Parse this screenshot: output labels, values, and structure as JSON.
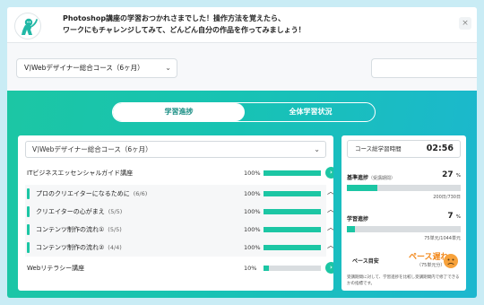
{
  "banner": {
    "line1": "Photoshop講座の学習おつかれさまでした！操作方法を覚えたら、",
    "line2": "ワークにもチャレンジしてみて、どんどん自分の作品を作ってみましょう！",
    "close": "×"
  },
  "course_select": {
    "value": "V)Webデザイナー総合コース（6ヶ月）",
    "chevron": "⌄"
  },
  "tabs": [
    {
      "label": "学習進捗",
      "active": true
    },
    {
      "label": "全体学習状況",
      "active": false
    }
  ],
  "progress_card": {
    "course_select": {
      "value": "V)Webデザイナー総合コース（6ヶ月）",
      "chevron": "⌄"
    },
    "rows": [
      {
        "label": "ITビジネスエッセンシャルガイド講座",
        "count": "",
        "percent": "100%",
        "progress": 1.0,
        "action": "›",
        "kind": "course"
      },
      {
        "label": "プロのクリエイターになるために",
        "count": "(6/6)",
        "percent": "100%",
        "progress": 1.0,
        "action": "︿",
        "kind": "chapter"
      },
      {
        "label": "クリエイターの心がまえ",
        "count": "(5/5)",
        "percent": "100%",
        "progress": 1.0,
        "action": "︿",
        "kind": "chapter"
      },
      {
        "label": "コンテンツ制作の流れ①",
        "count": "(5/5)",
        "percent": "100%",
        "progress": 1.0,
        "action": "︿",
        "kind": "chapter"
      },
      {
        "label": "コンテンツ制作の流れ②",
        "count": "(4/4)",
        "percent": "100%",
        "progress": 1.0,
        "action": "︿",
        "kind": "chapter"
      },
      {
        "label": "Webリテラシー講座",
        "count": "",
        "percent": "10%",
        "progress": 0.1,
        "action": "›",
        "kind": "course"
      }
    ]
  },
  "stats_card": {
    "total_time": {
      "label": "コース総学習時間",
      "value": "02:56"
    },
    "basic": {
      "title": "基準進捗",
      "subtitle": "（受講期間）",
      "value": "27",
      "unit": "%",
      "progress": 0.27,
      "note": "200日/730日"
    },
    "learning": {
      "title": "学習進捗",
      "value": "7",
      "unit": "%",
      "progress": 0.07,
      "note": "75単元/1044単元"
    },
    "pace": {
      "label": "ペース目安",
      "value": "ペース遅れ",
      "sub": "（75単元分）"
    },
    "description": "受講期間に対して、学習進捗を比較し受講期間内で修了できるかの指標です。"
  },
  "colors": {
    "accent": "#1cc6a4",
    "warning": "#f28a1f",
    "panel_end": "#1cb7cf"
  }
}
